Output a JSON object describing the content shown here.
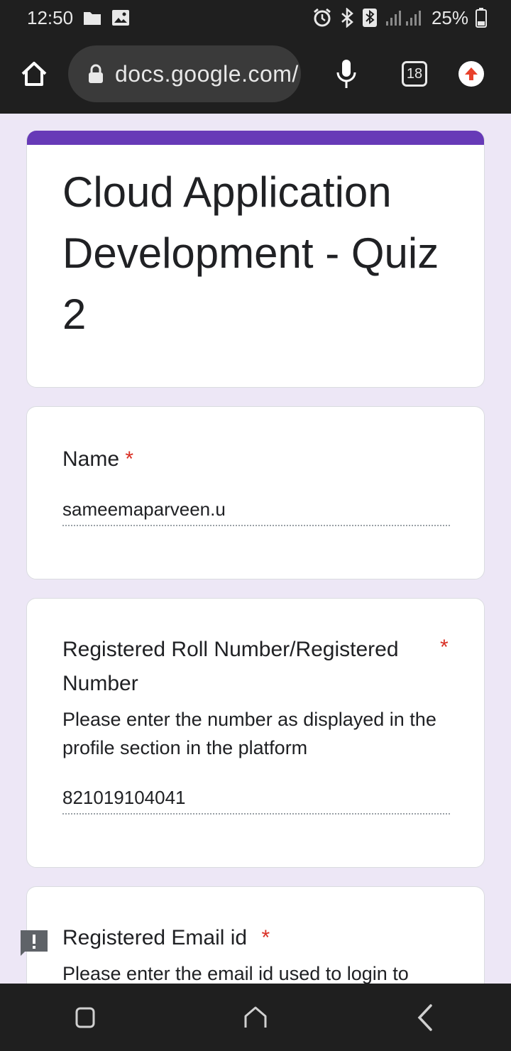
{
  "status_bar": {
    "time": "12:50",
    "battery": "25%",
    "icons": [
      "folder-icon",
      "image-icon",
      "alarm-icon",
      "bluetooth-icon",
      "signal-icon",
      "battery-icon"
    ]
  },
  "browser": {
    "url": "docs.google.com/",
    "tab_count": "18"
  },
  "form": {
    "accent_color": "#673ab7",
    "title": "Cloud Application Development - Quiz 2",
    "questions": [
      {
        "label": "Name",
        "required": "*",
        "answer": "sameemaparveen.u"
      },
      {
        "label": "Registered Roll Number/Registered Number",
        "required": "*",
        "description": "Please enter the number as displayed in the profile section in the platform",
        "answer": "821019104041"
      },
      {
        "label": "Registered Email id",
        "required": "*",
        "description": "Please enter the email id used to login to"
      }
    ]
  },
  "nav": {
    "buttons": [
      "recents-button",
      "home-button",
      "back-button"
    ]
  }
}
